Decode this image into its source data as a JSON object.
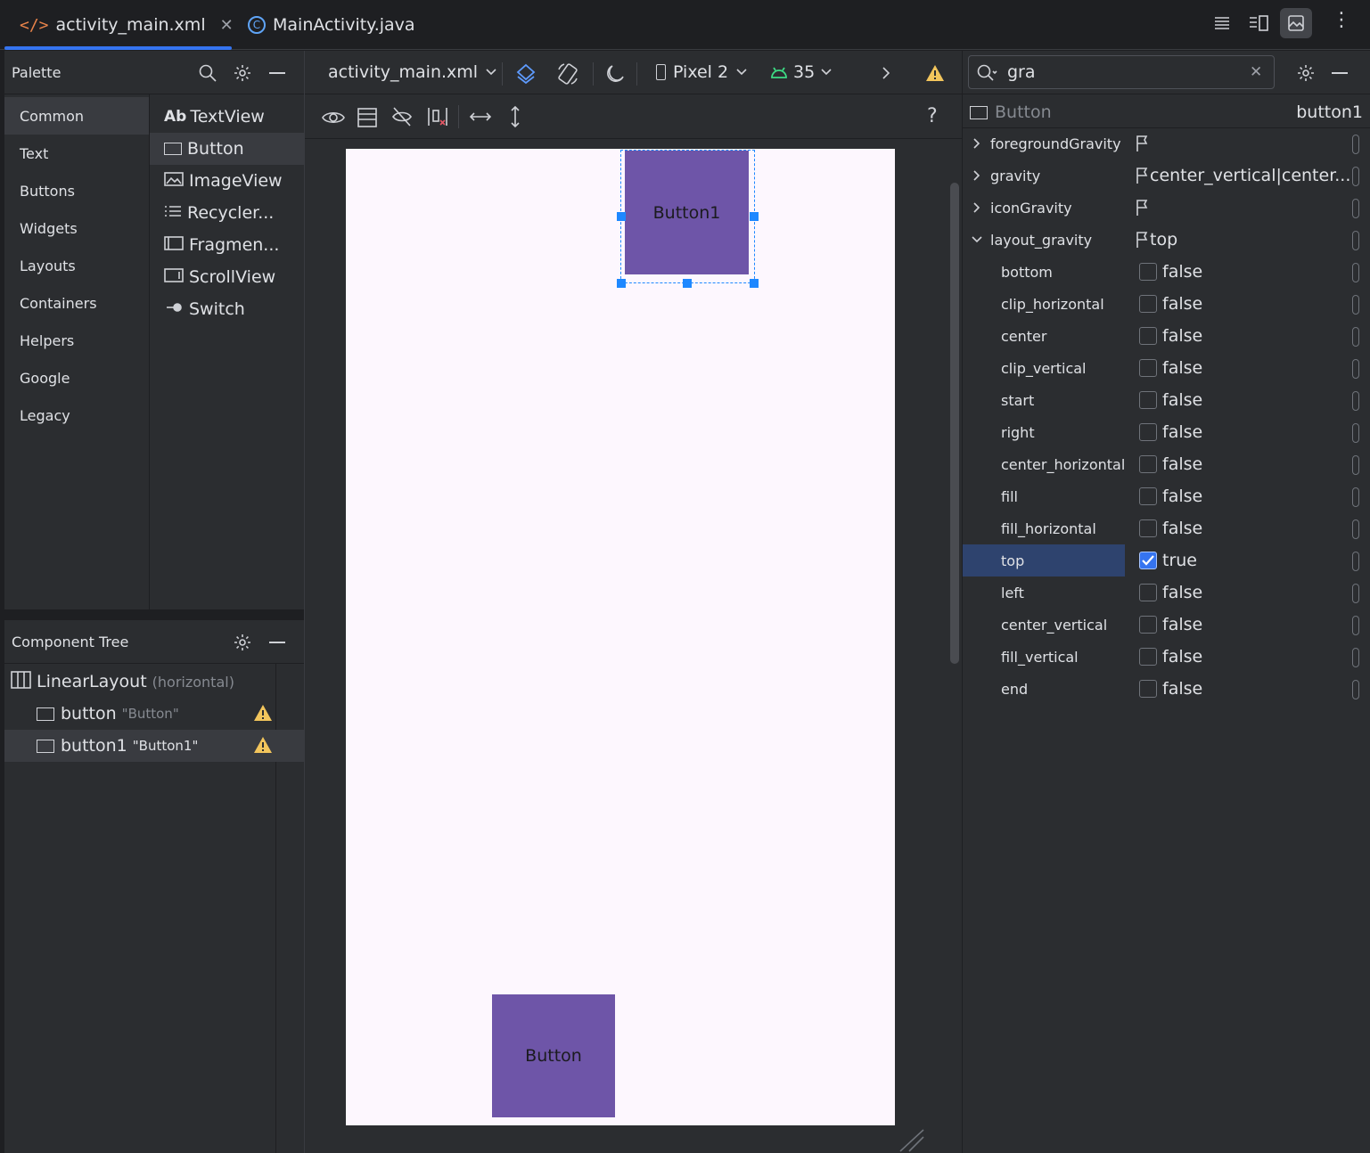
{
  "tabs": [
    {
      "label": "activity_main.xml",
      "active": true
    },
    {
      "label": "MainActivity.java",
      "active": false
    }
  ],
  "palette": {
    "title": "Palette",
    "categories": [
      "Common",
      "Text",
      "Buttons",
      "Widgets",
      "Layouts",
      "Containers",
      "Helpers",
      "Google",
      "Legacy"
    ],
    "selected_category": "Common",
    "items": [
      {
        "label": "TextView",
        "icon_text": "Ab"
      },
      {
        "label": "Button"
      },
      {
        "label": "ImageView"
      },
      {
        "label": "Recycler..."
      },
      {
        "label": "Fragmen..."
      },
      {
        "label": "ScrollView"
      },
      {
        "label": "Switch"
      }
    ],
    "selected_item": "Button"
  },
  "component_tree": {
    "title": "Component Tree",
    "root": {
      "name": "LinearLayout",
      "hint": "(horizontal)"
    },
    "children": [
      {
        "name": "button",
        "text": "\"Button\"",
        "warning": true
      },
      {
        "name": "button1",
        "text": "\"Button1\"",
        "warning": true
      }
    ]
  },
  "design_toolbar": {
    "file": "activity_main.xml",
    "device": "Pixel 2",
    "api": "35",
    "help": "?"
  },
  "canvas": {
    "button1_label": "Button1",
    "button_label": "Button",
    "colors": {
      "canvas_bg": "#fdf7fe",
      "button_fill": "#6e55a8",
      "selection": "#1e88ff"
    }
  },
  "attributes": {
    "search_value": "gra",
    "component_type": "Button",
    "component_id": "button1",
    "rows": [
      {
        "name": "foregroundGravity",
        "type": "flag",
        "value": "",
        "expander": "collapsed"
      },
      {
        "name": "gravity",
        "type": "flag",
        "value": "center_vertical|center...",
        "expander": "collapsed"
      },
      {
        "name": "iconGravity",
        "type": "flag",
        "value": "",
        "expander": "collapsed"
      },
      {
        "name": "layout_gravity",
        "type": "flag",
        "value": "top",
        "expander": "expanded"
      },
      {
        "name": "bottom",
        "type": "bool",
        "value": "false"
      },
      {
        "name": "clip_horizontal",
        "type": "bool",
        "value": "false"
      },
      {
        "name": "center",
        "type": "bool",
        "value": "false"
      },
      {
        "name": "clip_vertical",
        "type": "bool",
        "value": "false"
      },
      {
        "name": "start",
        "type": "bool",
        "value": "false"
      },
      {
        "name": "right",
        "type": "bool",
        "value": "false"
      },
      {
        "name": "center_horizontal",
        "type": "bool",
        "value": "false"
      },
      {
        "name": "fill",
        "type": "bool",
        "value": "false"
      },
      {
        "name": "fill_horizontal",
        "type": "bool",
        "value": "false"
      },
      {
        "name": "top",
        "type": "bool",
        "value": "true",
        "selected": true
      },
      {
        "name": "left",
        "type": "bool",
        "value": "false"
      },
      {
        "name": "center_vertical",
        "type": "bool",
        "value": "false"
      },
      {
        "name": "fill_vertical",
        "type": "bool",
        "value": "false"
      },
      {
        "name": "end",
        "type": "bool",
        "value": "false"
      }
    ]
  },
  "theme": {
    "accent": "#3574f0",
    "warning": "#f2c55c",
    "panel": "#2b2d30",
    "background": "#1e1f22",
    "selected_row": "#2e436e"
  }
}
